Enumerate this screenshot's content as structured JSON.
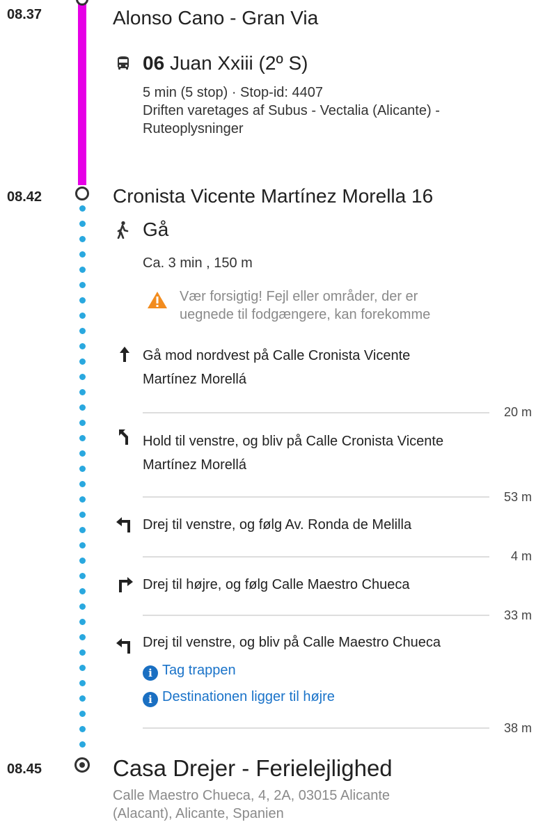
{
  "segments": {
    "bus": {
      "time": "08.37",
      "stop": "Alonso Cano - Gran Via",
      "route_number": "06",
      "route_name": "Juan Xxiii (2º S)",
      "duration": "5 min (5 stop) · Stop-id: 4407",
      "operator": "Driften varetages af Subus - Vectalia (Alicante) -",
      "route_info_link": "Ruteoplysninger",
      "line_color": "#e600e6"
    },
    "walk": {
      "time": "08.42",
      "stop": "Cronista Vicente Martínez Morella 16",
      "mode": "Gå",
      "duration": "Ca. 3 min , 150 m",
      "warning_line1": "Vær forsigtig! Fejl eller områder, der er",
      "warning_line2": "uegnede til fodgængere, kan forekomme",
      "dot_color": "#29a8df",
      "steps": [
        {
          "icon": "arrow-up-icon",
          "line1": "Gå mod nordvest på Calle Cronista Vicente",
          "line2": "Martínez Morellá",
          "distance": "20 m"
        },
        {
          "icon": "keep-left-icon",
          "line1": "Hold til venstre, og bliv på Calle Cronista Vicente",
          "line2": "Martínez Morellá",
          "distance": "53 m"
        },
        {
          "icon": "turn-left-icon",
          "line1": "Drej til venstre, og følg Av. Ronda de Melilla",
          "distance": "4 m"
        },
        {
          "icon": "turn-right-icon",
          "line1": "Drej til højre, og følg Calle Maestro Chueca",
          "distance": "33 m"
        },
        {
          "icon": "turn-left-icon",
          "line1": "Drej til venstre, og bliv på Calle Maestro Chueca",
          "distance": "38 m",
          "notes": [
            "Tag trappen",
            "Destinationen ligger til højre"
          ]
        }
      ]
    },
    "destination": {
      "time": "08.45",
      "name": "Casa Drejer - Ferielejlighed",
      "address_line1": "Calle Maestro Chueca, 4, 2A, 03015 Alicante",
      "address_line2": "(Alacant), Alicante, Spanien"
    }
  }
}
